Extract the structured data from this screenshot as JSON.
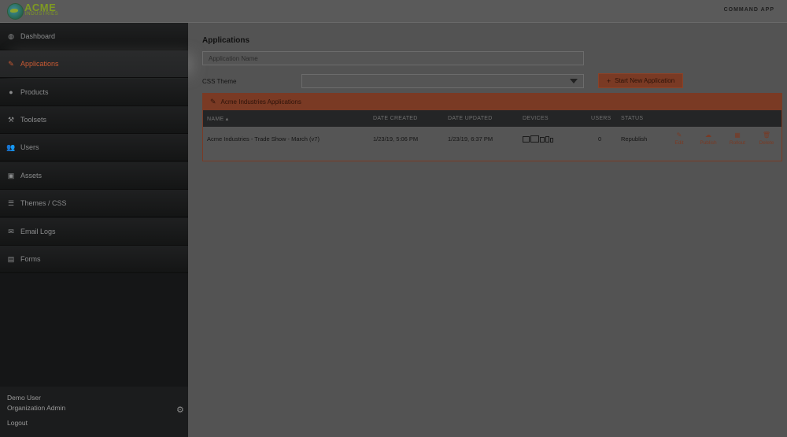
{
  "header": {
    "logo_word": "ACME",
    "logo_sub": "INDUSTRIES",
    "brand_right": "COMMAND APP"
  },
  "sidebar": {
    "items": [
      {
        "label": "Dashboard",
        "icon": "dashboard-icon",
        "glyph": "◍",
        "active": false
      },
      {
        "label": "Applications",
        "icon": "edit-icon",
        "glyph": "✎",
        "active": true
      },
      {
        "label": "Products",
        "icon": "products-icon",
        "glyph": "●",
        "active": false
      },
      {
        "label": "Toolsets",
        "icon": "wrench-icon",
        "glyph": "⚒",
        "active": false
      },
      {
        "label": "Users",
        "icon": "users-icon",
        "glyph": "👥",
        "active": false
      },
      {
        "label": "Assets",
        "icon": "image-icon",
        "glyph": "▣",
        "active": false
      },
      {
        "label": "Themes / CSS",
        "icon": "css-icon",
        "glyph": "☰",
        "active": false
      },
      {
        "label": "Email Logs",
        "icon": "envelope-icon",
        "glyph": "✉",
        "active": false
      },
      {
        "label": "Forms",
        "icon": "forms-icon",
        "glyph": "▤",
        "active": false
      }
    ],
    "footer": {
      "user_name": "Demo User",
      "user_role": "Organization Admin",
      "logout": "Logout"
    }
  },
  "main": {
    "title": "Applications",
    "name_placeholder": "Application Name",
    "css_theme_label": "CSS Theme",
    "css_theme_value": "",
    "new_app_button": "Start New Application",
    "panel": {
      "title": "Acme Industries Applications",
      "columns": {
        "name": "NAME",
        "created": "DATE CREATED",
        "updated": "DATE UPDATED",
        "devices": "DEVICES",
        "users": "USERS",
        "status": "STATUS"
      },
      "rows": [
        {
          "name": "Acme Industries - Trade Show - March (v7)",
          "created": "1/23/19, 5:06 PM",
          "updated": "1/23/19, 6:37 PM",
          "users": "0",
          "status": "Republish",
          "actions": {
            "edit": "Edit",
            "publish": "Publish",
            "rollout": "Rollout",
            "delete": "Delete"
          }
        }
      ]
    }
  },
  "colors": {
    "accent": "#7a3a24",
    "active_nav": "#c95a33",
    "sidebar_bg": "#151617",
    "main_bg": "#535353"
  }
}
